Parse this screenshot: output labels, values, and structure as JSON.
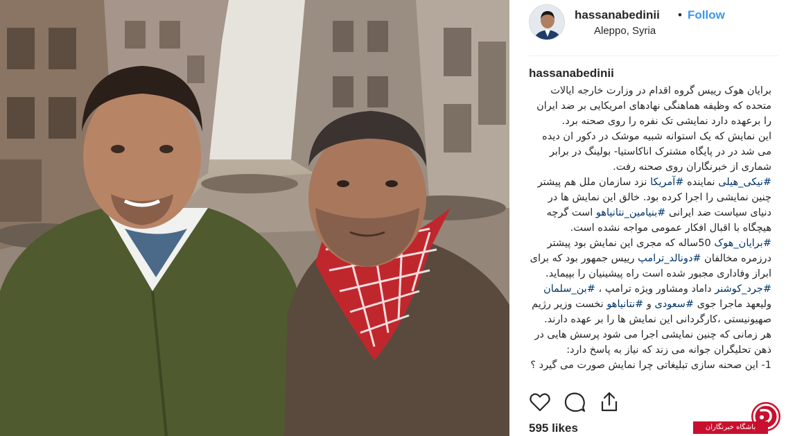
{
  "header": {
    "username": "hassanabedinii",
    "separator": "•",
    "follow_label": "Follow",
    "location": "Aleppo, Syria"
  },
  "caption": {
    "username": "hassanabedinii",
    "text": "برایان هوک رییس گروه اقدام در وزارت خارجه ایالات متحده که وظیفه هماهنگی نهادهای امریکایی بر ضد ایران را برعهده دارد نمایشی تک نفره را روی صحنه برد.\nاین نمایش که یک استوانه شبیه موشک در دکور ان دیده می شد در در پایگاه مشترک اناکاستیا- بولینگ در برابر شماری از خبرنگاران روی صحنه رفت.\n#نیکی_هیلی نماینده #آمریکا نزد سازمان ملل هم پیشتر چنین نمایشی را اجرا کرده بود. خالق این نمایش ها در دنیای سیاست ضد ایرانی #بنیامین_نتانیاهو است گرچه هیچگاه با اقبال افکار عمومی مواجه نشده است.\n#برایان_هوک 50ساله که مجری این نمایش بود پیشتر درزمره مخالفان #دونالد_ترامپ رییس جمهور بود که برای ابراز وفاداری مجبور شده است راه پیشینیان را بپیماید.\n#جرد_کوشنر داماد ومشاور ویژه ترامپ ، #بن_سلمان ولیعهد ماجرا جوی #سعودی و #نتانیاهو نخست وزیر رژیم صهیونیستی ،کارگردانی این نمایش ها را بر عهده دارند.\nهر زمانی که چنین نمایشی اجرا می شود پرسش هایی در ذهن تحلیگران جوانه می زند که نیاز به پاسخ دارد:\n1- این صحنه سازی تبلیغاتی چرا نمایش صورت می گیرد ؟"
  },
  "actions": {
    "like_icon": "heart-outline-icon",
    "comment_icon": "speech-bubble-icon",
    "share_icon": "share-upload-icon"
  },
  "likes_text": "595 likes",
  "watermark": {
    "text": "باشگاه خبرنگاران",
    "color": "#c8102e"
  },
  "colors": {
    "follow": "#3897f0",
    "hashtag": "#003569",
    "text": "#262626",
    "divider": "#efefef"
  }
}
